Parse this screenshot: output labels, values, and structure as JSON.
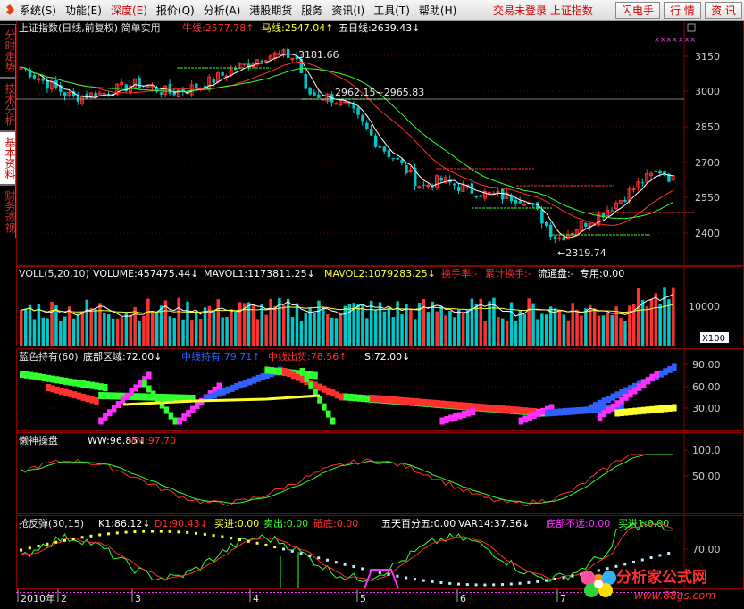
{
  "menubar": {
    "items": [
      {
        "label": "系统(S)",
        "active": false
      },
      {
        "label": "功能(E)",
        "active": false
      },
      {
        "label": "深度(E)",
        "active": true
      },
      {
        "label": "报价(Q)",
        "active": false
      },
      {
        "label": "分析(A)",
        "active": false
      },
      {
        "label": "港股期货",
        "active": false
      },
      {
        "label": "服务",
        "active": false
      },
      {
        "label": "资讯(I)",
        "active": false
      },
      {
        "label": "工具(T)",
        "active": false
      },
      {
        "label": "帮助(H)",
        "active": false
      }
    ],
    "status": "交易未登录  上证指数",
    "buttons": [
      "闪电手",
      "行 情",
      "资 讯"
    ]
  },
  "side_tabs": [
    "分时走势",
    "技术分析",
    "基本资料",
    "财务透视"
  ],
  "panels": {
    "main": {
      "title": "上证指数(日线,前复权) 简单实用",
      "items": [
        {
          "text": "牛线:2577.78↑",
          "color": "#ff3030"
        },
        {
          "text": "马线:2547.04↑",
          "color": "#ffff30"
        },
        {
          "text": "五日线:2639.43↓",
          "color": "#ffffff"
        }
      ],
      "axis": [
        "3150",
        "3000",
        "2850",
        "2700",
        "2550",
        "2400"
      ],
      "annotations": [
        "3181.66",
        "2962.15~2965.83",
        "←2319.74"
      ]
    },
    "volume": {
      "title": "VOLL(5,20,10)",
      "items": [
        {
          "text": "VOLUME:457475.44↓",
          "color": "#ffffff"
        },
        {
          "text": "MAVOL1:1173811.25↓",
          "color": "#ffffff"
        },
        {
          "text": "MAVOL2:1079283.25↓",
          "color": "#ffff30"
        },
        {
          "text": "换手率:-",
          "color": "#ff3030"
        },
        {
          "text": "累计换手:-",
          "color": "#ff3030"
        },
        {
          "text": "流通盘:-",
          "color": "#ffffff"
        },
        {
          "text": "专用:0.00",
          "color": "#ffffff"
        }
      ],
      "axis": [
        "10000"
      ],
      "unit": "X100"
    },
    "blue": {
      "title": "蓝色持有(60)",
      "items": [
        {
          "text": "底部区域:72.00↓",
          "color": "#ffffff"
        },
        {
          "text": "中线持有:79.71↑",
          "color": "#3060ff"
        },
        {
          "text": "中线出货:78.56↑",
          "color": "#ff3030"
        },
        {
          "text": "S:72.00↓",
          "color": "#ffffff"
        }
      ],
      "axis": [
        "90.00",
        "60.00",
        "30.00"
      ]
    },
    "lazy": {
      "title": "懒神操盘",
      "items": [
        {
          "text": "WW:96.85↓",
          "color": "#ffffff"
        },
        {
          "text": "MM:97.70",
          "color": "#ff3030"
        }
      ],
      "axis": [
        "100.0",
        "50.00"
      ]
    },
    "rebound": {
      "title": "抢反弹(30,15)",
      "items": [
        {
          "text": "K1:86.12↓",
          "color": "#ffffff"
        },
        {
          "text": "D1:90.43↓",
          "color": "#ff3030"
        },
        {
          "text": "买进:0.00",
          "color": "#ffff30"
        },
        {
          "text": "卖出:0.00",
          "color": "#30ff30"
        },
        {
          "text": "砥底:0.00",
          "color": "#ff3030"
        },
        {
          "text": "五天百分五:0.00",
          "color": "#ffffff"
        },
        {
          "text": "VAR14:37.36↓",
          "color": "#ffffff"
        },
        {
          "text": "底部不远:0.00",
          "color": "#ff30ff"
        },
        {
          "text": "买进1:0.00",
          "color": "#30ff30"
        }
      ],
      "axis": [
        "70.00"
      ]
    }
  },
  "time_axis": [
    "2010年",
    "2",
    "3",
    "4",
    "5",
    "6",
    "7"
  ],
  "watermark": {
    "title": "分析家公式网",
    "url": "www.88gs.com"
  }
}
